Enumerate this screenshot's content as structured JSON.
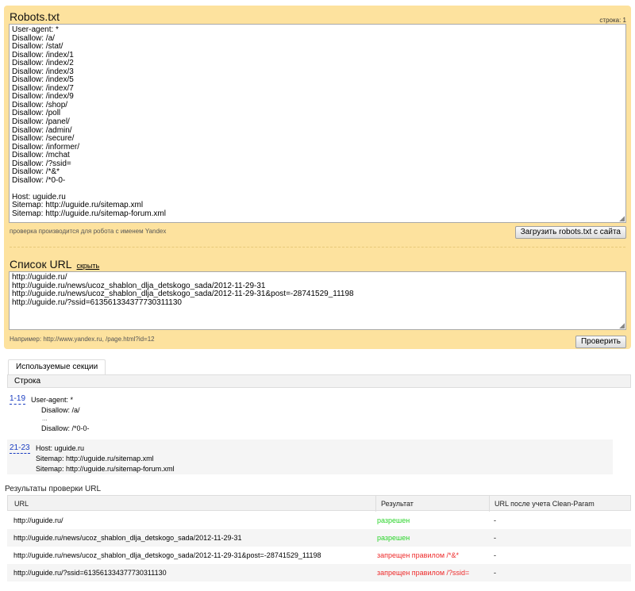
{
  "robots": {
    "title": "Robots.txt",
    "line_counter": "строка: 1",
    "content": "User-agent: *\nDisallow: /a/\nDisallow: /stat/\nDisallow: /index/1\nDisallow: /index/2\nDisallow: /index/3\nDisallow: /index/5\nDisallow: /index/7\nDisallow: /index/9\nDisallow: /shop/\nDisallow: /poll\nDisallow: /panel/\nDisallow: /admin/\nDisallow: /secure/\nDisallow: /informer/\nDisallow: /mchat\nDisallow: /?ssid=\nDisallow: /*&*\nDisallow: /*0-0-\n\nHost: uguide.ru\nSitemap: http://uguide.ru/sitemap.xml\nSitemap: http://uguide.ru/sitemap-forum.xml",
    "note": "проверка производится для робота с именем Yandex",
    "load_button": "Загрузить robots.txt с сайта"
  },
  "urls": {
    "title": "Список URL",
    "hide_link": "скрыть",
    "content": "http://uguide.ru/\nhttp://uguide.ru/news/ucoz_shablon_dlja_detskogo_sada/2012-11-29-31\nhttp://uguide.ru/news/ucoz_shablon_dlja_detskogo_sada/2012-11-29-31&post=-28741529_11198\nhttp://uguide.ru/?ssid=613561334377730311130",
    "example": "Например: http://www.yandex.ru, /page.html?id=12",
    "check_button": "Проверить"
  },
  "sections": {
    "tab_label": "Используемые секции",
    "column_header": "Строка",
    "blocks": [
      {
        "range": "1-19",
        "lines": [
          "User-agent: *",
          "Disallow: /a/",
          "...",
          "Disallow: /*0-0-"
        ]
      },
      {
        "range": "21-23",
        "lines": [
          "Host: uguide.ru",
          "Sitemap: http://uguide.ru/sitemap.xml",
          "Sitemap: http://uguide.ru/sitemap-forum.xml"
        ]
      }
    ]
  },
  "results": {
    "title": "Результаты проверки URL",
    "headers": [
      "URL",
      "Результат",
      "URL после учета Clean-Param"
    ],
    "rows": [
      {
        "url": "http://uguide.ru/",
        "result": "разрешен",
        "status": "allowed",
        "clean": "-"
      },
      {
        "url": "http://uguide.ru/news/ucoz_shablon_dlja_detskogo_sada/2012-11-29-31",
        "result": "разрешен",
        "status": "allowed",
        "clean": "-"
      },
      {
        "url": "http://uguide.ru/news/ucoz_shablon_dlja_detskogo_sada/2012-11-29-31&post=-28741529_11198",
        "result": "запрещен правилом /*&*",
        "status": "denied",
        "clean": "-"
      },
      {
        "url": "http://uguide.ru/?ssid=613561334377730311130",
        "result": "запрещен правилом /?ssid=",
        "status": "denied",
        "clean": "-"
      }
    ]
  },
  "colors": {
    "panel_bg": "#fde29e",
    "allowed": "#2ad42a",
    "denied": "#ee2b2b",
    "link": "#1a3dc1"
  }
}
